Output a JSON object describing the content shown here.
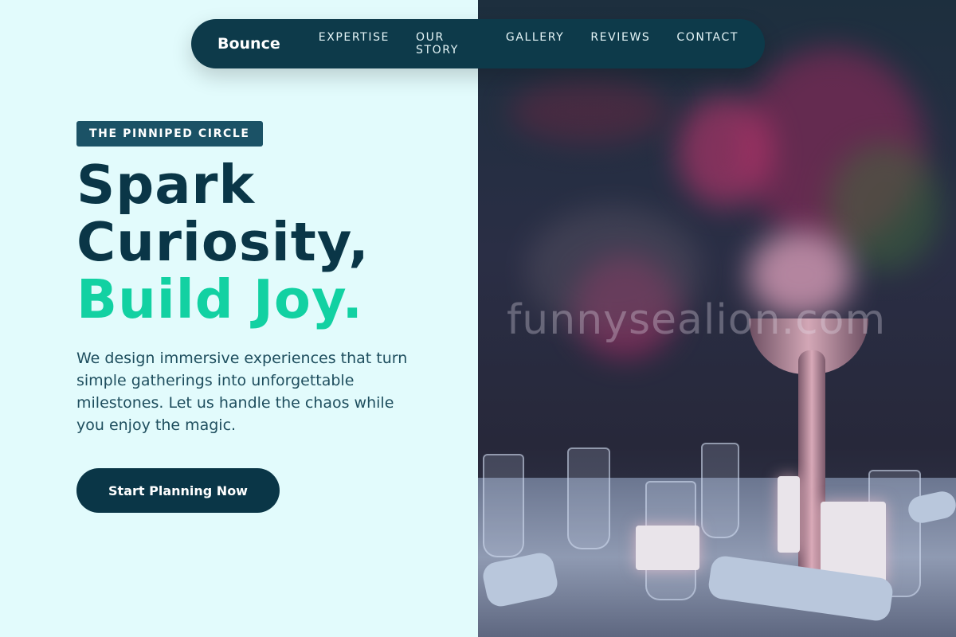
{
  "nav": {
    "brand": "Bounce",
    "links": [
      "EXPERTISE",
      "OUR STORY",
      "GALLERY",
      "REVIEWS",
      "CONTACT"
    ]
  },
  "hero": {
    "badge": "THE PINNIPED CIRCLE",
    "headline_line1": "Spark",
    "headline_line2": "Curiosity,",
    "headline_accent": "Build Joy.",
    "lead": "We design immersive experiences that turn simple gatherings into unforgettable milestones. Let us handle the chaos while you enjoy the magic.",
    "cta_label": "Start Planning Now"
  },
  "photo": {
    "watermark": "funnysealion.com"
  },
  "colors": {
    "background": "#e2fbfc",
    "nav": "#0d3a4a",
    "headline": "#0a3647",
    "accent": "#12d1a2",
    "badge": "#1b5266"
  }
}
